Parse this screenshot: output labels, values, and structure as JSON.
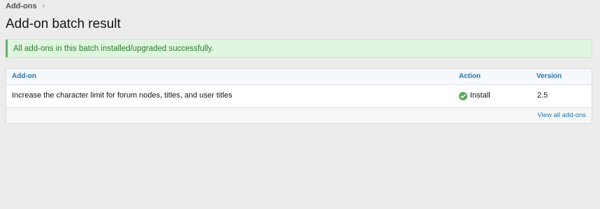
{
  "breadcrumb": {
    "items": [
      {
        "label": "Add-ons"
      }
    ]
  },
  "page": {
    "title": "Add-on batch result"
  },
  "notice": {
    "message": "All add-ons in this batch installed/upgraded successfully."
  },
  "table": {
    "columns": {
      "addon": "Add-on",
      "action": "Action",
      "version": "Version"
    },
    "rows": [
      {
        "addon": "Increase the character limit for forum nodes, titles, and user titles",
        "action": "Install",
        "action_icon": "check-circle-icon",
        "version": "2.5"
      }
    ],
    "footer_link": "View all add-ons"
  },
  "colors": {
    "background": "#ececec",
    "success_text": "#2d7c2f",
    "success_bg": "#dff5df",
    "success_icon": "#59a85c",
    "link": "#2577b1"
  }
}
